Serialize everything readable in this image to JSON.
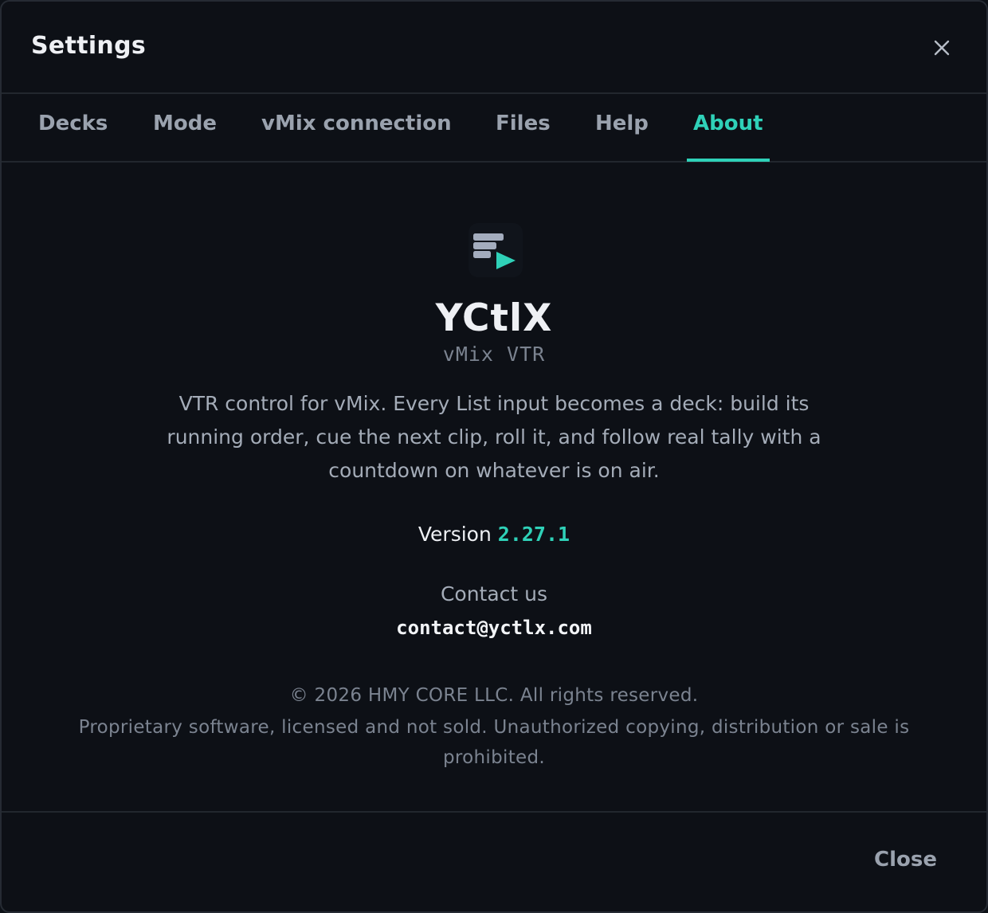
{
  "dialog": {
    "title": "Settings",
    "close_icon": "close-icon"
  },
  "tabs": [
    {
      "label": "Decks",
      "active": false
    },
    {
      "label": "Mode",
      "active": false
    },
    {
      "label": "vMix connection",
      "active": false
    },
    {
      "label": "Files",
      "active": false
    },
    {
      "label": "Help",
      "active": false
    },
    {
      "label": "About",
      "active": true
    }
  ],
  "about": {
    "logo_icon": "app-logo-icon",
    "app_name": "YCtlX",
    "app_subtitle": "vMix VTR",
    "description": "VTR control for vMix. Every List input becomes a deck: build its running order, cue the next clip, roll it, and follow real tally with a countdown on whatever is on air.",
    "version_label": "Version",
    "version_number": "2.27.1",
    "contact_label": "Contact us",
    "contact_email": "contact@yctlx.com",
    "copyright": "© 2026 HMY CORE LLC. All rights reserved.",
    "license": "Proprietary software, licensed and not sold. Unauthorized copying, distribution or sale is prohibited."
  },
  "footer": {
    "close_label": "Close"
  },
  "colors": {
    "accent": "#2fd1b8",
    "background": "#0d1016",
    "border": "#22272e",
    "text_primary": "#eef0f4",
    "text_secondary": "#a4acb8",
    "text_muted": "#7b8390"
  }
}
